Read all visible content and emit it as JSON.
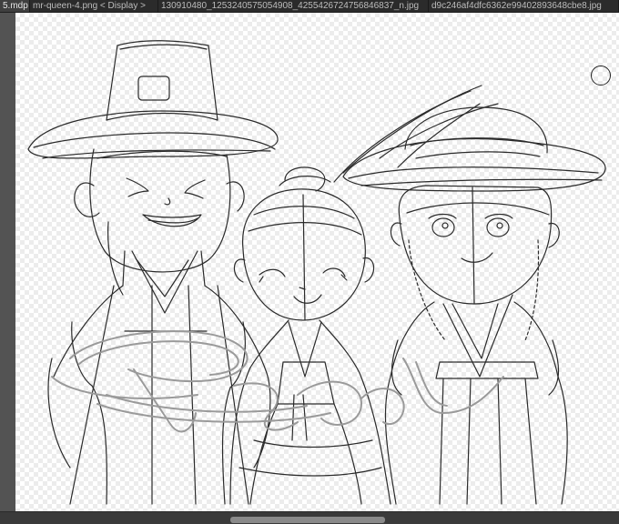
{
  "tabs": [
    {
      "label": "5.mdp",
      "active": true
    },
    {
      "label": "mr-queen-4.png < Display >",
      "active": false
    },
    {
      "label": "130910480_1253240575054908_4255426724756846837_n.jpg",
      "active": false
    },
    {
      "label": "d9c246af4dfc6362e99402893648cbe8.jpg",
      "active": false
    }
  ],
  "canvas": {
    "content": "pencil sketch of three chibi characters in traditional Korean clothing",
    "watermark_text": "Risyl"
  },
  "colors": {
    "app_background": "#535353",
    "tabbar_background": "#2b2b2b",
    "sketch_stroke": "#2a2a2a",
    "watermark_stroke": "#9a9a9a"
  }
}
